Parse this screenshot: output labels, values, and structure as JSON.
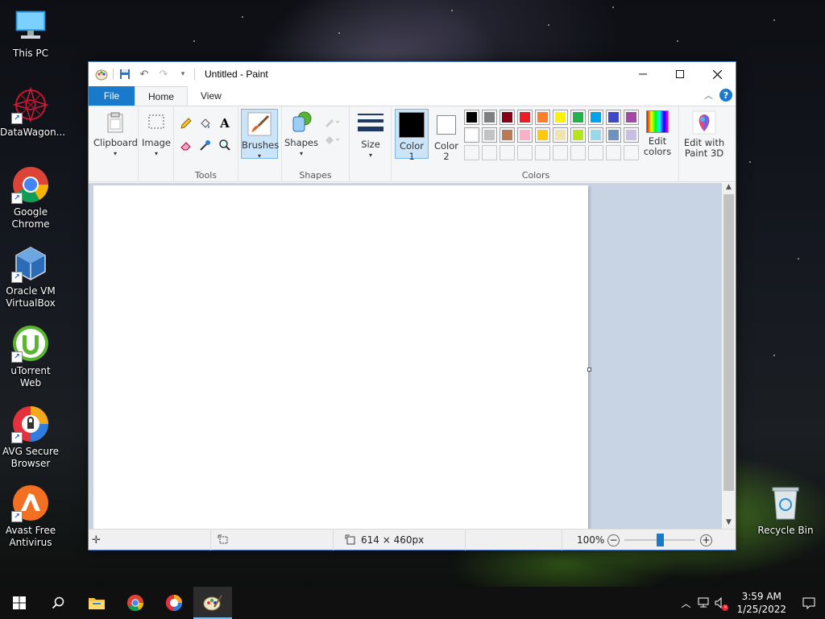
{
  "desktop": {
    "icons": [
      {
        "label": "This PC"
      },
      {
        "label": "DataWagon..."
      },
      {
        "label": "Google Chrome"
      },
      {
        "label": "Oracle VM VirtualBox"
      },
      {
        "label": "uTorrent Web"
      },
      {
        "label": "AVG Secure Browser"
      },
      {
        "label": "Avast Free Antivirus"
      },
      {
        "label": "Recycle Bin"
      }
    ]
  },
  "window": {
    "title": "Untitled - Paint",
    "tabs": [
      "File",
      "Home",
      "View"
    ],
    "groups": {
      "clipboard": "Clipboard",
      "image": "Image",
      "tools": "Tools",
      "brushes": "Brushes",
      "shapes_btn": "Shapes",
      "shapes": "Shapes",
      "size": "Size",
      "color1": "Color\n1",
      "color2": "Color\n2",
      "edit_colors": "Edit colors",
      "colors": "Colors",
      "paint3d": "Edit with Paint 3D"
    },
    "palette_row1": [
      "#000000",
      "#7f7f7f",
      "#880015",
      "#ed1c24",
      "#ff7f27",
      "#fff200",
      "#22b14c",
      "#00a2e8",
      "#3f48cc",
      "#a349a4"
    ],
    "palette_row2": [
      "#ffffff",
      "#c3c3c3",
      "#b97a57",
      "#ffaec9",
      "#ffc90e",
      "#efe4b0",
      "#b5e61d",
      "#99d9ea",
      "#7092be",
      "#c8bfe7"
    ],
    "status": {
      "dimensions": "614 × 460px",
      "zoom": "100%",
      "zoom_level_fraction": 0.5
    }
  },
  "taskbar": {
    "time": "3:59 AM",
    "date": "1/25/2022"
  }
}
